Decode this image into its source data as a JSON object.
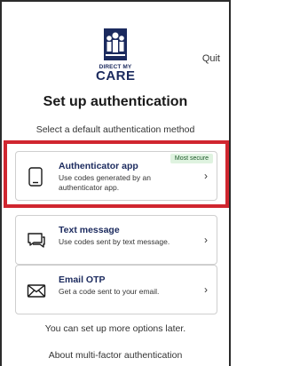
{
  "header": {
    "logo_line1": "DIRECT MY",
    "logo_line2": "CARE",
    "quit_label": "Quit"
  },
  "page": {
    "title": "Set up authentication",
    "subtitle": "Select a default authentication method"
  },
  "options": [
    {
      "icon": "smartphone-icon",
      "title": "Authenticator app",
      "description": "Use codes generated by an authenticator app.",
      "badge": "Most secure"
    },
    {
      "icon": "sms-message-icon",
      "title": "Text message",
      "description": "Use codes sent by text message."
    },
    {
      "icon": "email-icon",
      "title": "Email OTP",
      "description": "Get a code sent to your email."
    }
  ],
  "footer": {
    "note": "You can set up more options later.",
    "link": "About multi-factor authentication"
  },
  "colors": {
    "brand": "#1b2a5e",
    "highlight": "#d0262f",
    "badge_bg": "#dff3e0"
  }
}
